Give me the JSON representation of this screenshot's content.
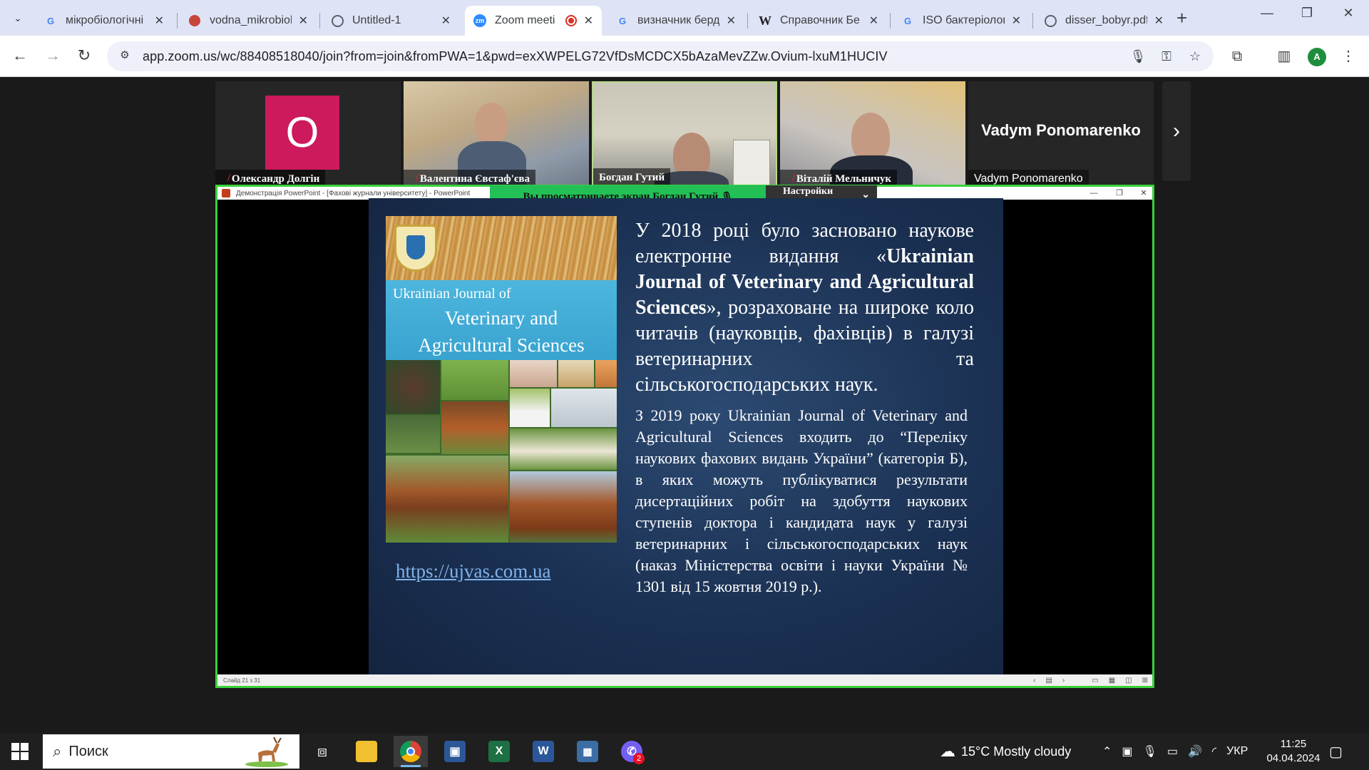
{
  "browser": {
    "tabs": [
      {
        "title": "мікробіологічні",
        "favicon": "google-icon"
      },
      {
        "title": "vodna_mikrobiol",
        "favicon": "site-icon"
      },
      {
        "title": "Untitled-1",
        "favicon": "globe-icon"
      },
      {
        "title": "Zoom meeti",
        "favicon": "zoom-icon",
        "active": true,
        "recording": true
      },
      {
        "title": "визначник берд",
        "favicon": "google-icon"
      },
      {
        "title": "Справочник Бе",
        "favicon": "wikipedia-icon"
      },
      {
        "title": "ISO бактеріолог",
        "favicon": "google-icon"
      },
      {
        "title": "disser_bobyr.pdf",
        "favicon": "globe-icon"
      }
    ],
    "url": "app.zoom.us/wc/88408518040/join?from=join&fromPWA=1&pwd=exXWPELG72VfDsMCDCX5bAzaMevZZw.Ovium-lxuM1HUCIV",
    "profile_initial": "A"
  },
  "zoom": {
    "participants": [
      {
        "name": "Олександр Долгін",
        "avatar_letter": "О",
        "muted": true
      },
      {
        "name": "Валентина Євстаф'єва",
        "muted": true
      },
      {
        "name": "Богдан Гутий",
        "muted": false,
        "speaking": true
      },
      {
        "name": "Віталій Мельничук",
        "muted": true
      },
      {
        "name": "Vadym Ponomarenko",
        "display_name": "Vadym Ponomarenko",
        "muted": false
      }
    ],
    "share": {
      "window_title": "Демонстрація PowerPoint - [Фахові журнали університету] - PowerPoint",
      "viewing_banner": "Вы просматриваете экран  Богдан Гутий",
      "view_settings": "Настройки просмотра",
      "status_bar": "Слайд 21 з 31"
    }
  },
  "slide": {
    "cover_journal_line1": "Ukrainian Journal of",
    "cover_journal_line2": "Veterinary and",
    "cover_journal_line3": "Agricultural Sciences",
    "para1_start": "У 2018 році було засновано наукове електронне видання «",
    "para1_bold": "Ukrainian Journal of Veterinary and Agricultural Sciences",
    "para1_end": "», розраховане на широке коло читачів (науковців, фахівців) в галузі ветеринарних та сільськогосподарських наук.",
    "para2": "З 2019 року Ukrainian Journal of Veterinary and Agricultural Sciences входить до “Переліку наукових фахових видань України” (категорія Б), в яких можуть публікуватися результати дисертаційних робіт на здобуття наукових ступенів доктора і кандидата наук у галузі ветеринарних і сільськогосподарських наук (наказ Міністерства освіти і науки України № 1301 від 15 жовтня 2019 р.).",
    "link": "https://ujvas.com.ua"
  },
  "taskbar": {
    "search_label": "Поиск",
    "weather": "15°C  Mostly cloudy",
    "language": "УКР",
    "time": "11:25",
    "date": "04.04.2024",
    "viber_badge": "2"
  }
}
